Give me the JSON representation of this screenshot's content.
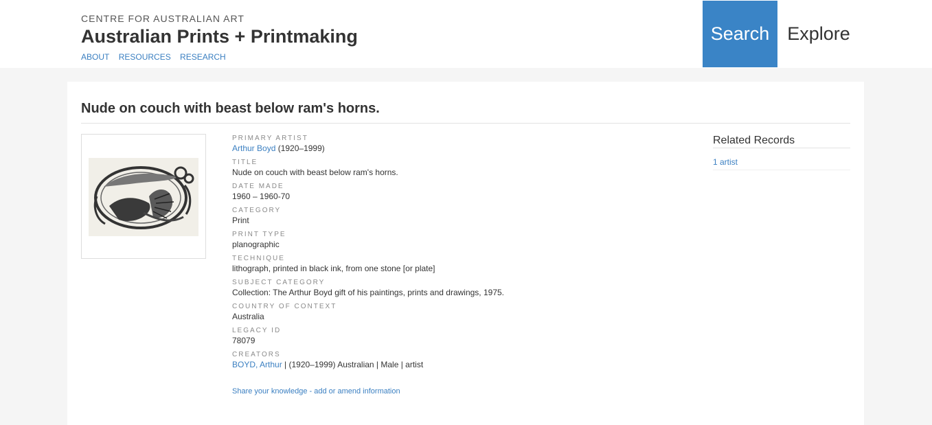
{
  "header": {
    "eyebrow": "CENTRE FOR AUSTRALIAN ART",
    "title": "Australian Prints + Printmaking",
    "nav": [
      "ABOUT",
      "RESOURCES",
      "RESEARCH"
    ],
    "search_label": "Search",
    "explore_label": "Explore",
    "accent": "#3a84c6"
  },
  "record": {
    "title": "Nude on couch with beast below ram's horns.",
    "fields": {
      "primary_artist": {
        "label": "PRIMARY ARTIST",
        "link": "Arthur Boyd",
        "rest": " (1920–1999)"
      },
      "title": {
        "label": "TITLE",
        "value": "Nude on couch with beast below ram's horns."
      },
      "date_made": {
        "label": "DATE MADE",
        "value": "1960 – 1960-70"
      },
      "category": {
        "label": "CATEGORY",
        "value": "Print"
      },
      "print_type": {
        "label": "PRINT TYPE",
        "value": "planographic"
      },
      "technique": {
        "label": "TECHNIQUE",
        "value": "lithograph, printed in black ink, from one stone [or plate]"
      },
      "subject_category": {
        "label": "SUBJECT CATEGORY",
        "value": "Collection: The Arthur Boyd gift of his paintings, prints and drawings, 1975."
      },
      "country": {
        "label": "COUNTRY OF CONTEXT",
        "value": "Australia"
      },
      "legacy_id": {
        "label": "LEGACY ID",
        "value": "78079"
      },
      "creators": {
        "label": "CREATORS",
        "link": "BOYD, Arthur",
        "rest": " | (1920–1999) Australian | Male | artist"
      }
    },
    "share_link": "Share your knowledge - add or amend information"
  },
  "related": {
    "heading": "Related Records",
    "items": [
      "1 artist"
    ]
  }
}
